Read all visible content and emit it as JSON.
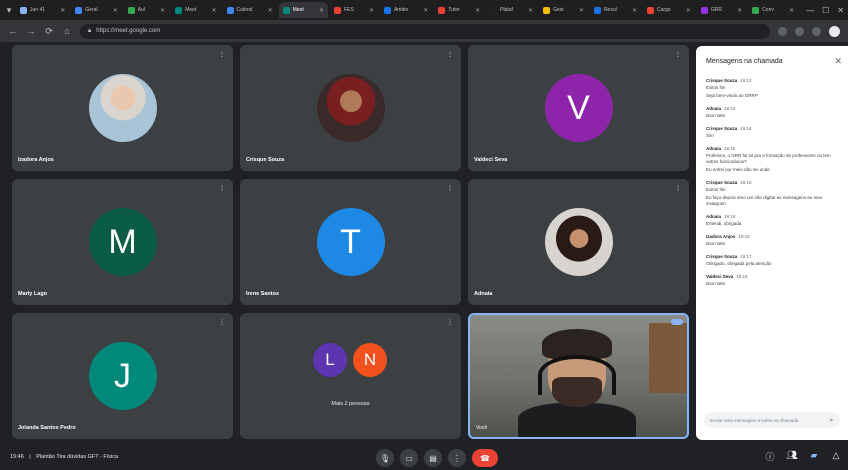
{
  "browser": {
    "tabs": [
      {
        "label": "Jun 41",
        "color": "#8ab4f8"
      },
      {
        "label": "Geral",
        "color": "#4285f4"
      },
      {
        "label": "Aul",
        "color": "#34a853"
      },
      {
        "label": "Meet",
        "color": "#00897b"
      },
      {
        "label": "Calend",
        "color": "#4285f4"
      },
      {
        "label": "Meet",
        "color": "#00897b"
      },
      {
        "label": "FES",
        "color": "#ea4335"
      },
      {
        "label": "Ambie",
        "color": "#1a73e8"
      },
      {
        "label": "Tutor",
        "color": "#ea4335"
      },
      {
        "label": "Plataf",
        "color": "#202124"
      },
      {
        "label": "Gest",
        "color": "#fbbc04"
      },
      {
        "label": "Resul",
        "color": "#1a73e8"
      },
      {
        "label": "Cargo",
        "color": "#ea4335"
      },
      {
        "label": "GRR",
        "color": "#9334e6"
      },
      {
        "label": "Conv",
        "color": "#34a853"
      }
    ],
    "url": "https://meet.google.com"
  },
  "tiles": [
    {
      "name": "Izadora Anjos",
      "type": "photo"
    },
    {
      "name": "Crisque Souza",
      "type": "photo"
    },
    {
      "name": "Valdeci Seva",
      "type": "avatar",
      "initial": "V",
      "color": "#8e24aa"
    },
    {
      "name": "Marly Lago",
      "type": "avatar",
      "initial": "M",
      "color": "#0b5c45"
    },
    {
      "name": "Irene Santos",
      "type": "avatar",
      "initial": "T",
      "color": "#1e88e5"
    },
    {
      "name": "Adnaia",
      "type": "photo"
    },
    {
      "name": "Jolanda Santos Pedro",
      "type": "avatar",
      "initial": "J",
      "color": "#00897b"
    },
    {
      "name": "",
      "type": "others",
      "initial_a": "L",
      "color_a": "#5e35b1",
      "initial_b": "N",
      "color_b": "#f4511e",
      "others_label": "Mais 2 pessoas"
    },
    {
      "name": "Você",
      "type": "video"
    }
  ],
  "chat": {
    "title": "Mensagens na chamada",
    "close_icon": "close-icon",
    "messages": [
      {
        "sender": "Crisque Souza",
        "time": "19:12",
        "lines": [
          "Exitos fim",
          "Seja bem-vindo ao GRRP"
        ]
      },
      {
        "sender": "Adnaia",
        "time": "19:13",
        "lines": [
          "Boa noite"
        ]
      },
      {
        "sender": "Crisque Souza",
        "time": "19:14",
        "lines": [
          "Sim"
        ]
      },
      {
        "sender": "Adnaia",
        "time": "19:15",
        "lines": [
          "Professor, o GRR foi só pra a formação de professores ou tem outros funcionários?",
          "Eu entrei por meio não sei onde"
        ]
      },
      {
        "sender": "Crisque Souza",
        "time": "19:15",
        "lines": [
          "Exitos fim",
          "Eu faço depois amo um não digitar as mensagens ao meu instagram"
        ]
      },
      {
        "sender": "Adnaia",
        "time": "19:16",
        "lines": [
          "Entendi, obrigada"
        ]
      },
      {
        "sender": "Izadora Anjos",
        "time": "19:16",
        "lines": [
          "Boa noite"
        ]
      },
      {
        "sender": "Crisque Souza",
        "time": "19:17",
        "lines": [
          "Obrigado, obrigada pela atenção"
        ]
      },
      {
        "sender": "Valdeci Seva",
        "time": "19:18",
        "lines": [
          "Boa noite"
        ]
      }
    ],
    "input_placeholder": "Enviar uma mensagem a todos na chamada"
  },
  "bottom": {
    "time": "19:46",
    "separator": "|",
    "meeting_title": "Plantão Tira dúvidas GFT - Física"
  }
}
